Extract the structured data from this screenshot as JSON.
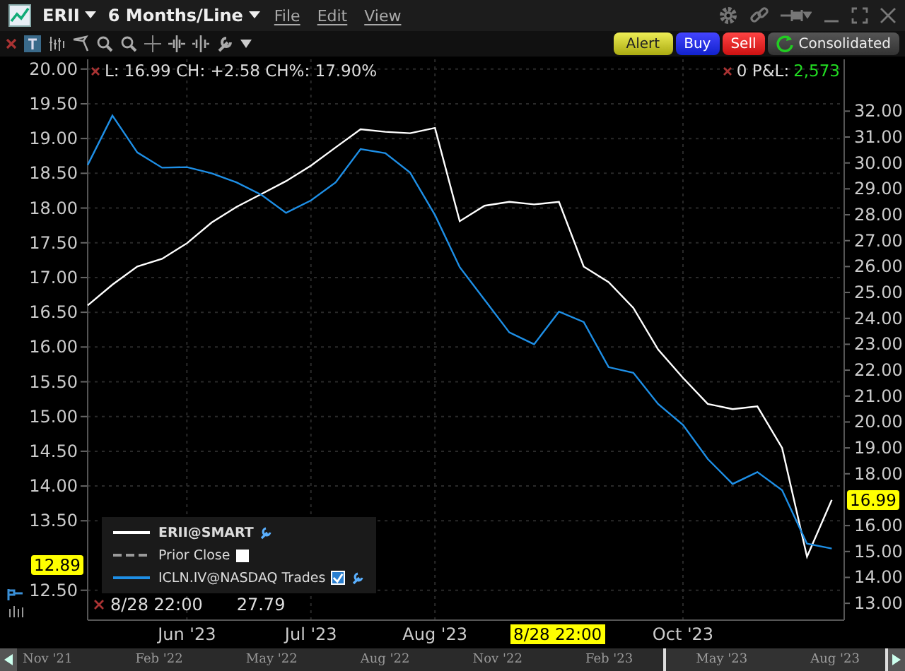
{
  "window": {
    "symbol": "ERII",
    "period": "6 Months/Line",
    "menu": [
      "File",
      "Edit",
      "View"
    ]
  },
  "order_buttons": [
    {
      "label": "Alert",
      "kind": "alert"
    },
    {
      "label": "Buy",
      "kind": "buy"
    },
    {
      "label": "Sell",
      "kind": "sell"
    },
    {
      "label": "Consolidated",
      "kind": "feed"
    }
  ],
  "info": {
    "quote": "L: 16.99 CH: +2.58 CH%: 17.90%",
    "position": "0 P&L:",
    "pnl": "2,573"
  },
  "cursor": {
    "time": "8/28 22:00",
    "value": "27.79",
    "axis_time": "8/28 22:00"
  },
  "price_tags": [
    {
      "kind": "right",
      "label": "16.99"
    },
    {
      "kind": "left",
      "label": "12.89"
    }
  ],
  "legend": [
    {
      "label": "ERII@SMART",
      "kind": "main",
      "color": "#ffffff"
    },
    {
      "label": "Prior Close",
      "kind": "prior",
      "color": "#9a9a9a",
      "checked": false
    },
    {
      "label": "ICLN.IV@NASDAQ Trades",
      "kind": "overlay",
      "color": "#1e8fe6",
      "checked": true
    }
  ],
  "chart_data": {
    "type": "line",
    "grid": true,
    "categories": [
      null,
      null,
      null,
      null,
      "Jun '23",
      null,
      null,
      null,
      null,
      "Jul '23",
      null,
      null,
      null,
      null,
      "Aug '23",
      null,
      null,
      null,
      null,
      null,
      null,
      null,
      null,
      null,
      "Oct '23",
      null,
      null,
      null,
      null,
      null,
      null
    ],
    "series": [
      {
        "color": "#ffffff",
        "axis": "y2",
        "values": [
          24.5,
          25.3,
          26.0,
          26.3,
          26.9,
          27.7,
          28.3,
          28.8,
          29.3,
          29.9,
          30.6,
          31.3,
          31.2,
          31.15,
          31.35,
          27.75,
          28.35,
          28.5,
          28.4,
          28.5,
          26.0,
          25.4,
          24.4,
          22.8,
          21.7,
          20.7,
          20.5,
          20.6,
          19.0,
          14.8,
          16.99
        ]
      },
      {
        "color": "#1e8fe6",
        "values": [
          18.62,
          19.33,
          18.8,
          18.58,
          18.59,
          18.5,
          18.37,
          18.19,
          17.93,
          18.11,
          18.37,
          18.85,
          18.79,
          18.51,
          17.9,
          17.15,
          16.68,
          16.21,
          16.04,
          16.51,
          16.36,
          15.71,
          15.63,
          15.18,
          14.88,
          14.39,
          14.03,
          14.2,
          13.94,
          13.17,
          13.1
        ]
      }
    ],
    "ylim": [
      12.07,
      20.14
    ],
    "yticks": [
      {
        "value": 20,
        "label": "20.00"
      },
      {
        "value": 19.5,
        "label": "19.50"
      },
      {
        "value": 19,
        "label": "19.00"
      },
      {
        "value": 18.5,
        "label": "18.50"
      },
      {
        "value": 18,
        "label": "18.00"
      },
      {
        "value": 17.5,
        "label": "17.50"
      },
      {
        "value": 17,
        "label": "17.00"
      },
      {
        "value": 16.5,
        "label": "16.50"
      },
      {
        "value": 16,
        "label": "16.00"
      },
      {
        "value": 15.5,
        "label": "15.50"
      },
      {
        "value": 15,
        "label": "15.00"
      },
      {
        "value": 14.5,
        "label": "14.50"
      },
      {
        "value": 14,
        "label": "14.00"
      },
      {
        "value": 13.5,
        "label": "13.50"
      },
      {
        "value": 12.5,
        "label": "12.50"
      }
    ],
    "y2lim": [
      12.35,
      34
    ],
    "y2ticks": [
      {
        "value": 32,
        "label": "32.00"
      },
      {
        "value": 31,
        "label": "31.00"
      },
      {
        "value": 30,
        "label": "30.00"
      },
      {
        "value": 29,
        "label": "29.00"
      },
      {
        "value": 28,
        "label": "28.00"
      },
      {
        "value": 27,
        "label": "27.00"
      },
      {
        "value": 26,
        "label": "26.00"
      },
      {
        "value": 25,
        "label": "25.00"
      },
      {
        "value": 24,
        "label": "24.00"
      },
      {
        "value": 23,
        "label": "23.00"
      },
      {
        "value": 22,
        "label": "22.00"
      },
      {
        "value": 21,
        "label": "21.00"
      },
      {
        "value": 20,
        "label": "20.00"
      },
      {
        "value": 19,
        "label": "19.00"
      },
      {
        "value": 18,
        "label": "18.00"
      },
      {
        "value": 16,
        "label": "16.00"
      },
      {
        "value": 15,
        "label": "15.00"
      },
      {
        "value": 14,
        "label": "14.00"
      },
      {
        "value": 13,
        "label": "13.00"
      }
    ]
  },
  "navigator": [
    "Nov '21",
    "Feb '22",
    "May '22",
    "Aug '22",
    "Nov '22",
    "Feb '23",
    "May '23",
    "Aug '23"
  ]
}
